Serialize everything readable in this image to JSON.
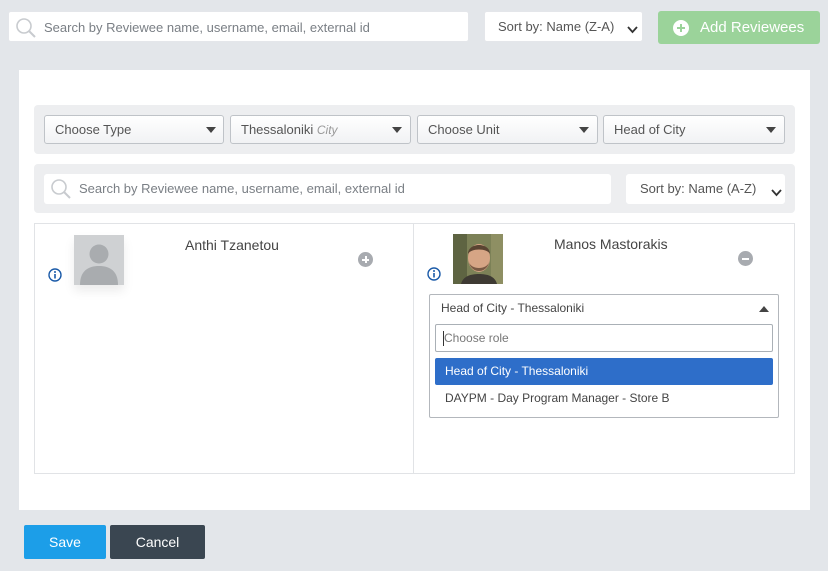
{
  "top_bar": {
    "search_placeholder": "Search by Reviewee name, username, email, external id",
    "sort_label": "Sort by: Name (Z-A)",
    "add_button_label": "Add Reviewees"
  },
  "filters": [
    {
      "label": "Choose Type",
      "hint": ""
    },
    {
      "label": "Thessaloniki",
      "hint": "City"
    },
    {
      "label": "Choose Unit",
      "hint": ""
    },
    {
      "label": "Head of City",
      "hint": ""
    }
  ],
  "inner_search": {
    "placeholder": "Search by Reviewee name, username, email, external id",
    "sort_label": "Sort by: Name (A-Z)"
  },
  "reviewees": {
    "available": {
      "name": "Anthi Tzanetou"
    },
    "selected": {
      "name": "Manos Mastorakis",
      "role_selected": "Head of City - Thessaloniki",
      "role_search_placeholder": "Choose role",
      "role_options": [
        "Head of City - Thessaloniki",
        "DAYPM - Day Program Manager - Store B"
      ]
    }
  },
  "footer": {
    "save_label": "Save",
    "cancel_label": "Cancel"
  },
  "colors": {
    "accent_blue": "#1c9ee8",
    "add_green": "#9bd39a",
    "option_highlight": "#2e6ec9",
    "cancel_dark": "#3a4651"
  },
  "icons": [
    "search-icon",
    "chevron-down-icon",
    "plus-circle-icon",
    "info-icon",
    "minus-circle-icon",
    "caret-up-icon",
    "caret-down-icon"
  ]
}
